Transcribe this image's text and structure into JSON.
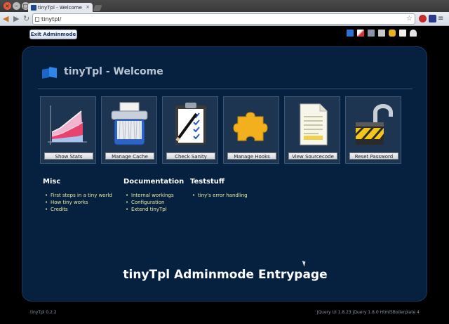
{
  "browser": {
    "tab_title": "tinyTpl - Welcome",
    "url": "tinytpl/"
  },
  "page": {
    "exit_button": "Exit Adminmode",
    "site_title": "tinyTpl - Welcome",
    "tiles": [
      {
        "label": "Show Stats",
        "icon": "chart-icon"
      },
      {
        "label": "Manage Cache",
        "icon": "shredder-icon"
      },
      {
        "label": "Check Sanity",
        "icon": "clipboard-icon"
      },
      {
        "label": "Manage Hooks",
        "icon": "puzzle-icon"
      },
      {
        "label": "View Sourcecode",
        "icon": "document-icon"
      },
      {
        "label": "Reset Password",
        "icon": "unlock-icon"
      }
    ],
    "misc": {
      "heading": "Misc",
      "links": [
        "First steps in a tiny world",
        "How tiny works",
        "Credits"
      ]
    },
    "documentation": {
      "heading": "Documentation",
      "links": [
        "Internal workings",
        "Configuration",
        "Extend tinyTpl"
      ]
    },
    "teststuff": {
      "heading": "Teststuff",
      "links": [
        "tiny's error handling"
      ]
    },
    "caption": "tinyTpl Adminmode Entrypage",
    "footer_left": "tinyTpl 0.2.2",
    "footer_right": "jQuery UI 1.8.23   jQuery 1.8.0   Html5Boilerplate 4"
  },
  "colors": {
    "panel": "#05213f",
    "link": "#e8e9a0",
    "tile": "#1d3550"
  }
}
